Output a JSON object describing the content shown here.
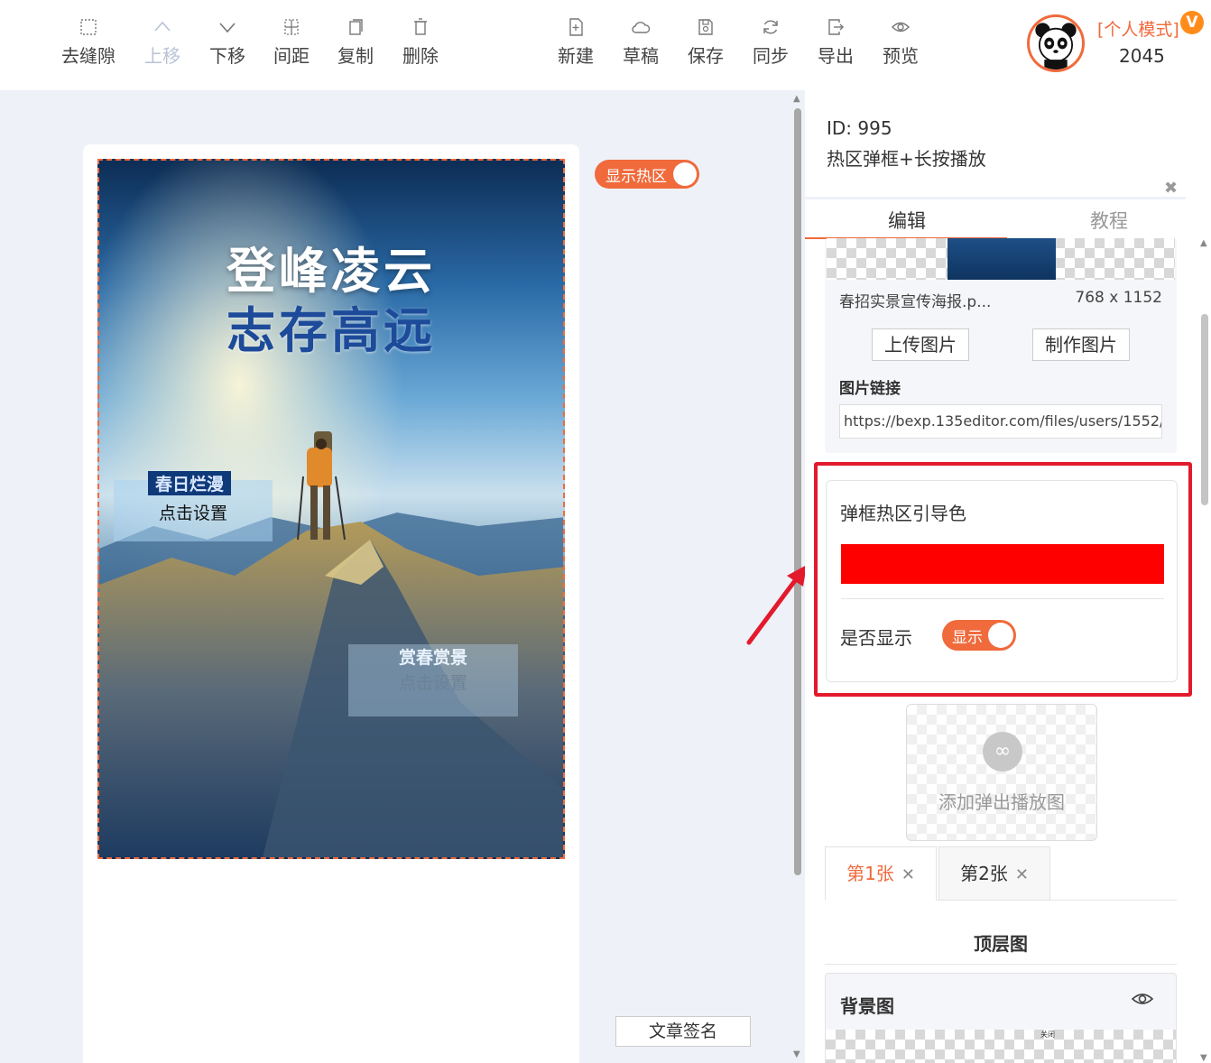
{
  "toolbar": {
    "edit_tools": [
      {
        "label": "去缝隙",
        "icon": "grid-square-icon",
        "enabled": true
      },
      {
        "label": "上移",
        "icon": "chevron-up-icon",
        "enabled": false
      },
      {
        "label": "下移",
        "icon": "chevron-down-icon",
        "enabled": true
      },
      {
        "label": "间距",
        "icon": "spacing-icon",
        "enabled": true
      },
      {
        "label": "复制",
        "icon": "copy-icon",
        "enabled": true
      },
      {
        "label": "删除",
        "icon": "trash-icon",
        "enabled": true
      }
    ],
    "file_tools": [
      {
        "label": "新建",
        "icon": "new-file-icon"
      },
      {
        "label": "草稿",
        "icon": "cloud-icon"
      },
      {
        "label": "保存",
        "icon": "save-icon"
      },
      {
        "label": "同步",
        "icon": "sync-icon"
      },
      {
        "label": "导出",
        "icon": "export-icon"
      },
      {
        "label": "预览",
        "icon": "eye-icon"
      }
    ],
    "user": {
      "mode": "[个人模式]",
      "badge": "V",
      "score": "2045"
    }
  },
  "canvas": {
    "toggle_hotzone": "显示热区",
    "poster_title_1": "登峰凌云",
    "poster_title_2": "志存高远",
    "hotzones": [
      {
        "tag": "春日烂漫",
        "label": "点击设置"
      },
      {
        "tag": "赏春赏景",
        "label": "点击设置"
      }
    ],
    "sign_button": "文章签名"
  },
  "panel": {
    "id_text": "ID: 995",
    "name": "热区弹框+长按播放",
    "tabs": {
      "edit": "编辑",
      "tutorial": "教程"
    },
    "image": {
      "filename": "春招实景宣传海报.p...",
      "size": "768 x 1152",
      "upload": "上传图片",
      "make": "制作图片",
      "link_label": "图片链接",
      "link_value": "https://bexp.135editor.com/files/users/1552/"
    },
    "color_card": {
      "title": "弹框热区引导色",
      "color": "#ff0000",
      "show_label": "是否显示",
      "show_toggle": "显示"
    },
    "add_popup": "添加弹出播放图",
    "slides": [
      {
        "label": "第1张"
      },
      {
        "label": "第2张"
      }
    ],
    "top_layer": "顶层图",
    "background": {
      "label": "背景图",
      "close_text": "关闭"
    }
  },
  "colors": {
    "accent": "#f06a3c",
    "highlight": "#e21a2c"
  }
}
